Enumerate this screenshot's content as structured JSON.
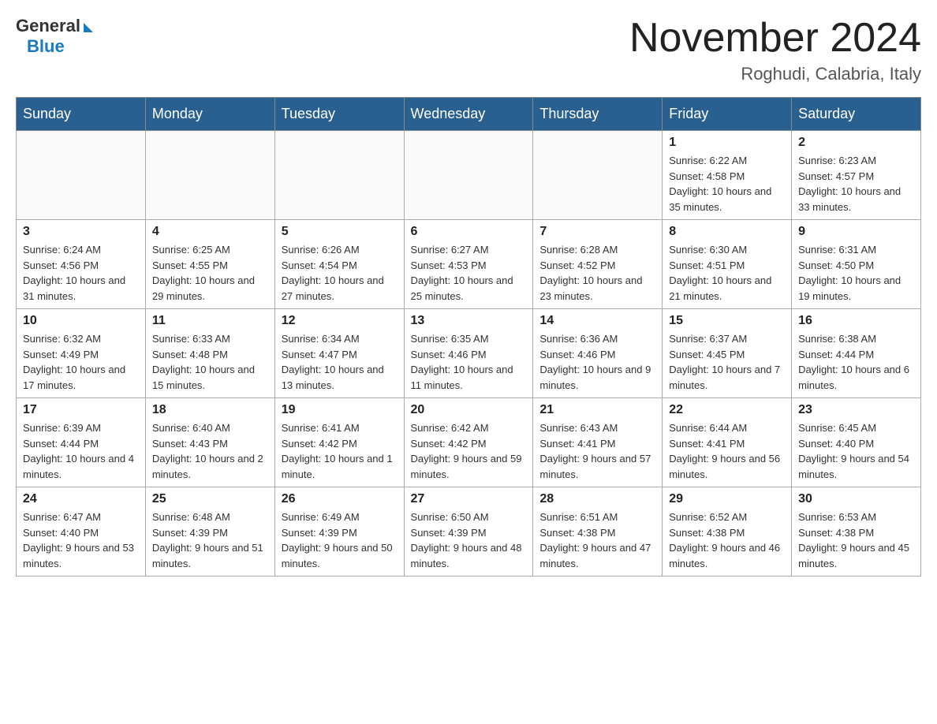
{
  "logo": {
    "general": "General",
    "blue": "Blue"
  },
  "title": "November 2024",
  "location": "Roghudi, Calabria, Italy",
  "weekdays": [
    "Sunday",
    "Monday",
    "Tuesday",
    "Wednesday",
    "Thursday",
    "Friday",
    "Saturday"
  ],
  "weeks": [
    [
      {
        "day": "",
        "info": ""
      },
      {
        "day": "",
        "info": ""
      },
      {
        "day": "",
        "info": ""
      },
      {
        "day": "",
        "info": ""
      },
      {
        "day": "",
        "info": ""
      },
      {
        "day": "1",
        "info": "Sunrise: 6:22 AM\nSunset: 4:58 PM\nDaylight: 10 hours and 35 minutes."
      },
      {
        "day": "2",
        "info": "Sunrise: 6:23 AM\nSunset: 4:57 PM\nDaylight: 10 hours and 33 minutes."
      }
    ],
    [
      {
        "day": "3",
        "info": "Sunrise: 6:24 AM\nSunset: 4:56 PM\nDaylight: 10 hours and 31 minutes."
      },
      {
        "day": "4",
        "info": "Sunrise: 6:25 AM\nSunset: 4:55 PM\nDaylight: 10 hours and 29 minutes."
      },
      {
        "day": "5",
        "info": "Sunrise: 6:26 AM\nSunset: 4:54 PM\nDaylight: 10 hours and 27 minutes."
      },
      {
        "day": "6",
        "info": "Sunrise: 6:27 AM\nSunset: 4:53 PM\nDaylight: 10 hours and 25 minutes."
      },
      {
        "day": "7",
        "info": "Sunrise: 6:28 AM\nSunset: 4:52 PM\nDaylight: 10 hours and 23 minutes."
      },
      {
        "day": "8",
        "info": "Sunrise: 6:30 AM\nSunset: 4:51 PM\nDaylight: 10 hours and 21 minutes."
      },
      {
        "day": "9",
        "info": "Sunrise: 6:31 AM\nSunset: 4:50 PM\nDaylight: 10 hours and 19 minutes."
      }
    ],
    [
      {
        "day": "10",
        "info": "Sunrise: 6:32 AM\nSunset: 4:49 PM\nDaylight: 10 hours and 17 minutes."
      },
      {
        "day": "11",
        "info": "Sunrise: 6:33 AM\nSunset: 4:48 PM\nDaylight: 10 hours and 15 minutes."
      },
      {
        "day": "12",
        "info": "Sunrise: 6:34 AM\nSunset: 4:47 PM\nDaylight: 10 hours and 13 minutes."
      },
      {
        "day": "13",
        "info": "Sunrise: 6:35 AM\nSunset: 4:46 PM\nDaylight: 10 hours and 11 minutes."
      },
      {
        "day": "14",
        "info": "Sunrise: 6:36 AM\nSunset: 4:46 PM\nDaylight: 10 hours and 9 minutes."
      },
      {
        "day": "15",
        "info": "Sunrise: 6:37 AM\nSunset: 4:45 PM\nDaylight: 10 hours and 7 minutes."
      },
      {
        "day": "16",
        "info": "Sunrise: 6:38 AM\nSunset: 4:44 PM\nDaylight: 10 hours and 6 minutes."
      }
    ],
    [
      {
        "day": "17",
        "info": "Sunrise: 6:39 AM\nSunset: 4:44 PM\nDaylight: 10 hours and 4 minutes."
      },
      {
        "day": "18",
        "info": "Sunrise: 6:40 AM\nSunset: 4:43 PM\nDaylight: 10 hours and 2 minutes."
      },
      {
        "day": "19",
        "info": "Sunrise: 6:41 AM\nSunset: 4:42 PM\nDaylight: 10 hours and 1 minute."
      },
      {
        "day": "20",
        "info": "Sunrise: 6:42 AM\nSunset: 4:42 PM\nDaylight: 9 hours and 59 minutes."
      },
      {
        "day": "21",
        "info": "Sunrise: 6:43 AM\nSunset: 4:41 PM\nDaylight: 9 hours and 57 minutes."
      },
      {
        "day": "22",
        "info": "Sunrise: 6:44 AM\nSunset: 4:41 PM\nDaylight: 9 hours and 56 minutes."
      },
      {
        "day": "23",
        "info": "Sunrise: 6:45 AM\nSunset: 4:40 PM\nDaylight: 9 hours and 54 minutes."
      }
    ],
    [
      {
        "day": "24",
        "info": "Sunrise: 6:47 AM\nSunset: 4:40 PM\nDaylight: 9 hours and 53 minutes."
      },
      {
        "day": "25",
        "info": "Sunrise: 6:48 AM\nSunset: 4:39 PM\nDaylight: 9 hours and 51 minutes."
      },
      {
        "day": "26",
        "info": "Sunrise: 6:49 AM\nSunset: 4:39 PM\nDaylight: 9 hours and 50 minutes."
      },
      {
        "day": "27",
        "info": "Sunrise: 6:50 AM\nSunset: 4:39 PM\nDaylight: 9 hours and 48 minutes."
      },
      {
        "day": "28",
        "info": "Sunrise: 6:51 AM\nSunset: 4:38 PM\nDaylight: 9 hours and 47 minutes."
      },
      {
        "day": "29",
        "info": "Sunrise: 6:52 AM\nSunset: 4:38 PM\nDaylight: 9 hours and 46 minutes."
      },
      {
        "day": "30",
        "info": "Sunrise: 6:53 AM\nSunset: 4:38 PM\nDaylight: 9 hours and 45 minutes."
      }
    ]
  ]
}
